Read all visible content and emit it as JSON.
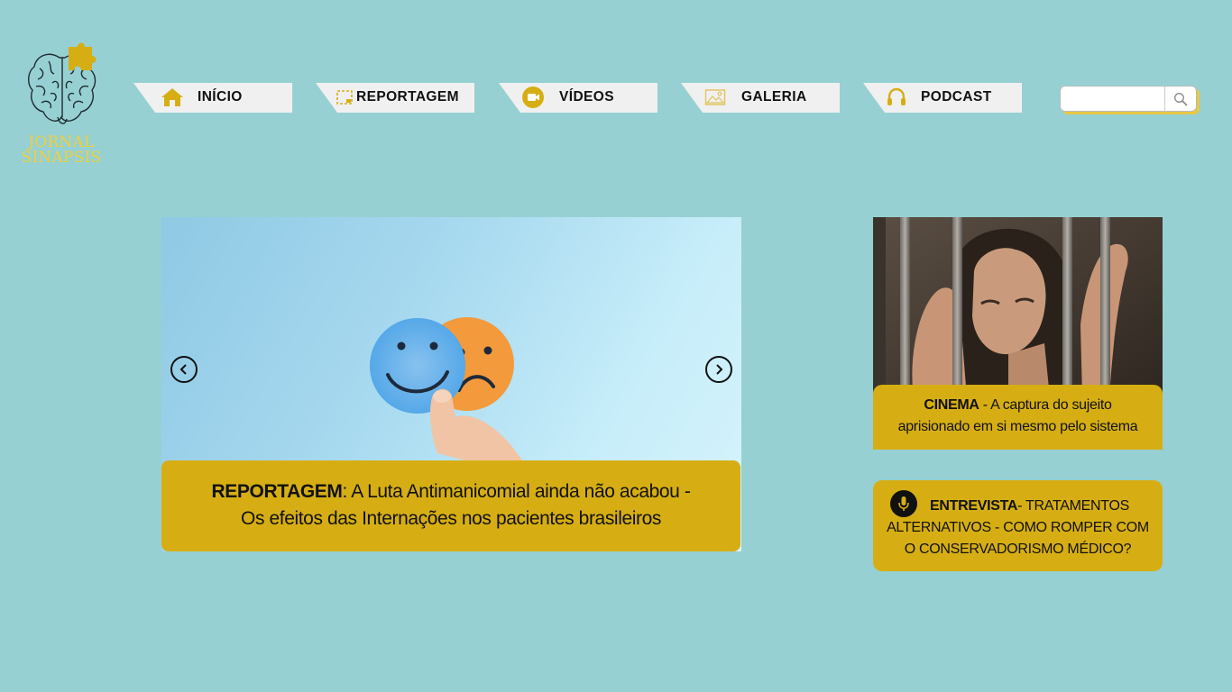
{
  "logo": {
    "line1": "JORNAL",
    "line2": "SINAPSIS",
    "icon": "brain-puzzle-icon"
  },
  "nav": [
    {
      "label": "INÍCIO",
      "icon": "home-icon"
    },
    {
      "label": "REPORTAGEM",
      "icon": "newspaper-icon"
    },
    {
      "label": "VÍDEOS",
      "icon": "video-camera-icon"
    },
    {
      "label": "GALERIA",
      "icon": "image-icon"
    },
    {
      "label": "PODCAST",
      "icon": "headphones-icon"
    }
  ],
  "search": {
    "placeholder": "",
    "icon": "search-icon"
  },
  "featured": {
    "tag": "REPORTAGEM",
    "line1": ": A Luta Antimanicomial ainda não acabou -",
    "line2": "Os efeitos das Internações nos pacientes brasileiros"
  },
  "side_cards": {
    "cinema": {
      "tag": "CINEMA",
      "line1": " - A captura do sujeito",
      "line2": "aprisionado em si mesmo pelo sistema"
    },
    "interview": {
      "tag": "ENTREVISTA",
      "line1": "- TRATAMENTOS",
      "line2": "ALTERNATIVOS - COMO ROMPER COM",
      "line3": "O CONSERVADORISMO MÉDICO?",
      "icon": "microphone-icon"
    }
  },
  "colors": {
    "background": "#97d0d2",
    "accent": "#d6ae14",
    "logo": "#efcf3a",
    "nav_bg": "#f0f0f0"
  }
}
